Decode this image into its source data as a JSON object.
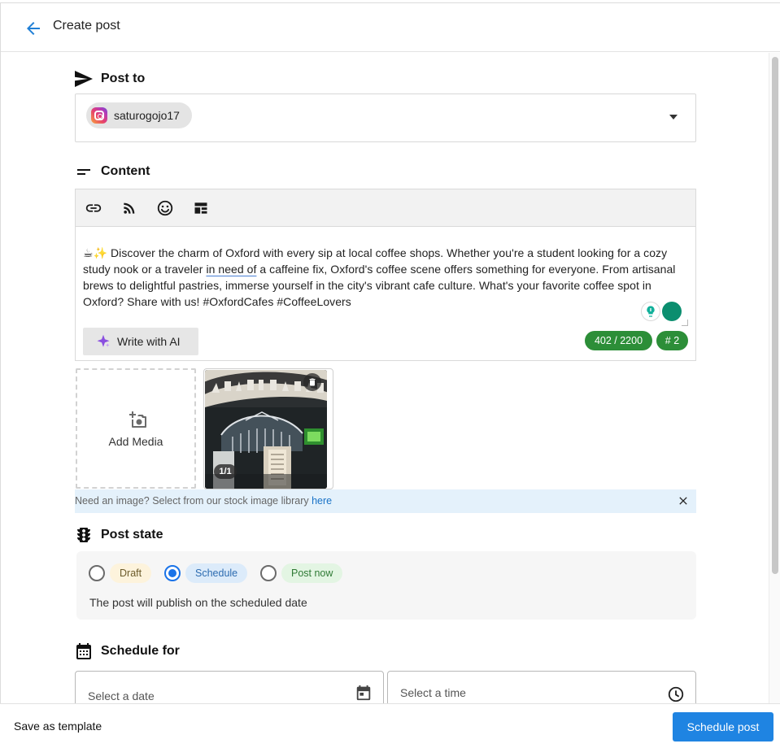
{
  "header": {
    "title": "Create post"
  },
  "post_to": {
    "label": "Post to",
    "account": {
      "handle": "saturogojo17",
      "platform_icon": "instagram-icon"
    }
  },
  "content": {
    "label": "Content",
    "toolbar_icons": [
      "link-icon",
      "rss-feed-icon",
      "emoji-icon",
      "template-layout-icon"
    ],
    "text_before": "☕✨ Discover the charm of Oxford with every sip at local coffee shops. Whether you're a student looking for a cozy study nook or a traveler ",
    "text_underlined": "in need of",
    "text_after": " a caffeine fix, Oxford's coffee scene offers something for everyone. From artisanal brews to delightful pastries, immerse yourself in the city's vibrant cafe culture. What's your favorite coffee spot in Oxford? Share with us! #OxfordCafes #CoffeeLovers",
    "ai_button_label": "Write with AI",
    "char_count": "402 / 2200",
    "hashtag_count": "# 2"
  },
  "media": {
    "add_label": "Add Media",
    "counter": "1/1",
    "stock_hint": "Need an image? Select from our stock image library ",
    "stock_link": "here"
  },
  "post_state": {
    "label": "Post state",
    "options": [
      {
        "label": "Draft",
        "selected": false,
        "bg": "#fdf3dc",
        "fg": "#6b5a2a"
      },
      {
        "label": "Schedule",
        "selected": true,
        "bg": "#dcebfa",
        "fg": "#2c6bb0"
      },
      {
        "label": "Post now",
        "selected": false,
        "bg": "#e3f5e3",
        "fg": "#2f7a35"
      }
    ],
    "description": "The post will publish on the scheduled date"
  },
  "schedule": {
    "label": "Schedule for",
    "date_placeholder": "Select a date",
    "time_placeholder": "Select a time"
  },
  "footer": {
    "template_label": "Save as template",
    "submit_label": "Schedule post"
  },
  "colors": {
    "accent": "#1f84e2",
    "badge_green": "#2c8e38",
    "stock_bar": "#e4f1fb"
  }
}
